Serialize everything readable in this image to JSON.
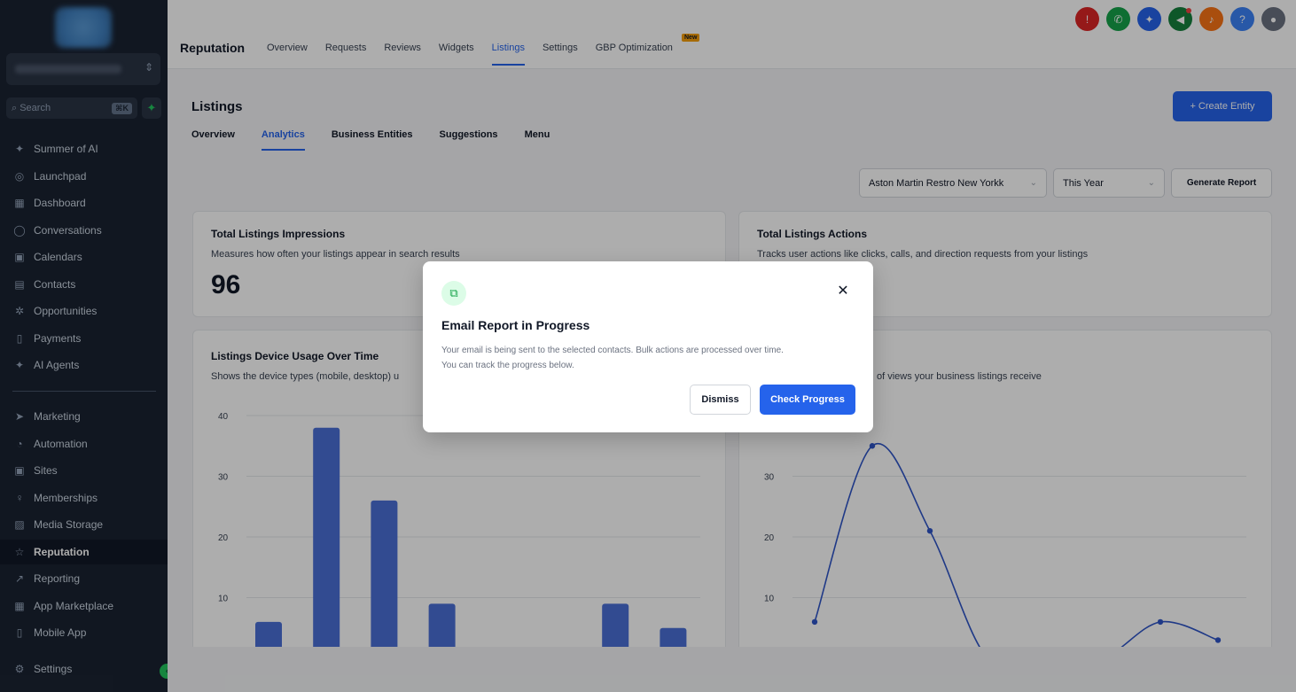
{
  "sidebar": {
    "search_placeholder": "Search",
    "search_shortcut": "⌘K",
    "items_top": [
      {
        "label": "Summer of AI",
        "icon": "sparkle-icon",
        "glyph": "✦"
      },
      {
        "label": "Launchpad",
        "icon": "rocket-icon",
        "glyph": "◎"
      },
      {
        "label": "Dashboard",
        "icon": "grid-icon",
        "glyph": "▦"
      },
      {
        "label": "Conversations",
        "icon": "chat-icon",
        "glyph": "◯"
      },
      {
        "label": "Calendars",
        "icon": "calendar-icon",
        "glyph": "▣"
      },
      {
        "label": "Contacts",
        "icon": "contacts-icon",
        "glyph": "▤"
      },
      {
        "label": "Opportunities",
        "icon": "opportunities-icon",
        "glyph": "✲"
      },
      {
        "label": "Payments",
        "icon": "payments-icon",
        "glyph": "▯"
      },
      {
        "label": "AI Agents",
        "icon": "ai-agents-icon",
        "glyph": "✦"
      }
    ],
    "items_bottom": [
      {
        "label": "Marketing",
        "icon": "send-icon",
        "glyph": "➤"
      },
      {
        "label": "Automation",
        "icon": "automation-icon",
        "glyph": "◔"
      },
      {
        "label": "Sites",
        "icon": "sites-icon",
        "glyph": "▣"
      },
      {
        "label": "Memberships",
        "icon": "memberships-icon",
        "glyph": "♀"
      },
      {
        "label": "Media Storage",
        "icon": "media-icon",
        "glyph": "▨"
      },
      {
        "label": "Reputation",
        "icon": "star-icon",
        "glyph": "☆",
        "active": true
      },
      {
        "label": "Reporting",
        "icon": "trend-icon",
        "glyph": "↗"
      },
      {
        "label": "App Marketplace",
        "icon": "apps-icon",
        "glyph": "▦"
      },
      {
        "label": "Mobile App",
        "icon": "mobile-icon",
        "glyph": "▯"
      }
    ],
    "settings_label": "Settings"
  },
  "header": {
    "title": "Reputation",
    "tabs": [
      "Overview",
      "Requests",
      "Reviews",
      "Widgets",
      "Listings",
      "Settings",
      "GBP Optimization"
    ],
    "active_tab": "Listings",
    "new_badge": "New"
  },
  "page": {
    "title": "Listings",
    "create_label": "+ Create Entity",
    "subtabs": [
      "Overview",
      "Analytics",
      "Business Entities",
      "Suggestions",
      "Menu"
    ],
    "active_subtab": "Analytics",
    "location_select": "Aston Martin Restro New Yorkk",
    "period_select": "This Year",
    "generate_label": "Generate Report"
  },
  "cards": {
    "impressions": {
      "title": "Total Listings Impressions",
      "subtitle": "Measures how often your listings appear in search results",
      "value": "96"
    },
    "actions": {
      "title": "Total Listings Actions",
      "subtitle": "Tracks user actions like clicks, calls, and direction requests from your listings"
    },
    "device": {
      "title": "Listings Device Usage Over Time",
      "subtitle": "Shows the device types (mobile, desktop) u"
    },
    "views": {
      "subtitle": "of views your business listings receive"
    }
  },
  "modal": {
    "title": "Email Report in Progress",
    "body_line1": "Your email is being sent to the selected contacts. Bulk actions are processed over time.",
    "body_line2": "You can track the progress below.",
    "dismiss_label": "Dismiss",
    "check_label": "Check Progress"
  },
  "chart_data": [
    {
      "type": "bar",
      "values": [
        6,
        38,
        26,
        9,
        0,
        0,
        9,
        5
      ],
      "yticks": [
        10,
        20,
        30,
        40
      ],
      "ylim": [
        0,
        40
      ],
      "color": "#4a6fd6"
    },
    {
      "type": "line",
      "values": [
        6,
        35,
        21,
        0,
        0,
        0,
        6,
        3
      ],
      "yticks": [
        10,
        20,
        30
      ],
      "ylim": [
        0,
        40
      ],
      "color": "#2f55c7"
    }
  ],
  "top_icons": [
    {
      "name": "alert-icon",
      "color": "#dc2626",
      "glyph": "!"
    },
    {
      "name": "phone-icon",
      "color": "#16a34a",
      "glyph": "✆"
    },
    {
      "name": "magic-icon",
      "color": "#2563eb",
      "glyph": "✦"
    },
    {
      "name": "megaphone-icon",
      "color": "#15803d",
      "glyph": "◀",
      "dot": true
    },
    {
      "name": "bell-icon",
      "color": "#f97316",
      "glyph": "♪"
    },
    {
      "name": "help-icon",
      "color": "#3b82f6",
      "glyph": "?"
    },
    {
      "name": "avatar",
      "color": "#6b7280",
      "glyph": "●"
    }
  ]
}
